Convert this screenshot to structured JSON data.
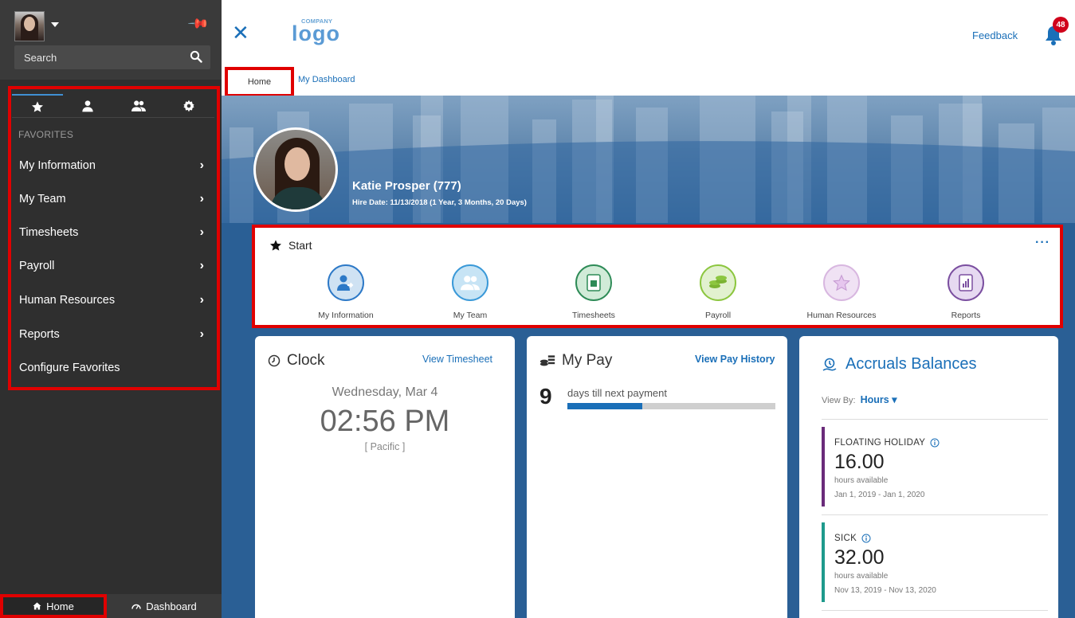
{
  "sidebar": {
    "search_placeholder": "Search",
    "section_title": "FAVORITES",
    "items": [
      {
        "label": "My Information"
      },
      {
        "label": "My Team"
      },
      {
        "label": "Timesheets"
      },
      {
        "label": "Payroll"
      },
      {
        "label": "Human Resources"
      },
      {
        "label": "Reports"
      },
      {
        "label": "Configure Favorites"
      }
    ],
    "bottom": {
      "home_label": "Home",
      "dashboard_label": "Dashboard"
    }
  },
  "header": {
    "logo_small": "COMPANY",
    "logo_big": "logo",
    "feedback_label": "Feedback",
    "notification_count": "48"
  },
  "tabs": [
    {
      "label": "Home"
    },
    {
      "label": "My Dashboard"
    }
  ],
  "profile": {
    "name": "Katie Prosper (777)",
    "hire_date": "Hire Date: 11/13/2018 (1 Year, 3 Months, 20 Days)"
  },
  "start": {
    "title": "Start",
    "more": "···",
    "shortcuts": [
      {
        "label": "My Information",
        "color": "#2d79c7",
        "bg": "#dbe9f6"
      },
      {
        "label": "My Team",
        "color": "#3a99d8",
        "bg": "#d5ecf8"
      },
      {
        "label": "Timesheets",
        "color": "#2e8b57",
        "bg": "#d9eede"
      },
      {
        "label": "Payroll",
        "color": "#8cc63f",
        "bg": "#e7f3d6"
      },
      {
        "label": "Human Resources",
        "color": "#c59ad2",
        "bg": "#f2e6f5"
      },
      {
        "label": "Reports",
        "color": "#7b4fa0",
        "bg": "#ece2f3"
      }
    ]
  },
  "clock": {
    "title": "Clock",
    "link": "View Timesheet",
    "day": "Wednesday, Mar 4",
    "time": "02:56 PM",
    "timezone": "[ Pacific ]"
  },
  "pay": {
    "title": "My Pay",
    "link": "View Pay History",
    "days": "9",
    "days_label": "days till next payment",
    "progress": 0.36
  },
  "accruals": {
    "title": "Accruals Balances",
    "view_by_label": "View By:",
    "view_by_value": "Hours",
    "entries": [
      {
        "name": "FLOATING HOLIDAY",
        "value": "16.00",
        "sub": "hours available",
        "dates": "Jan 1, 2019 - Jan 1, 2020",
        "color": "#6a2b7a"
      },
      {
        "name": "SICK",
        "value": "32.00",
        "sub": "hours available",
        "dates": "Nov 13, 2019 - Nov 13, 2020",
        "color": "#1e9a8c"
      }
    ]
  }
}
